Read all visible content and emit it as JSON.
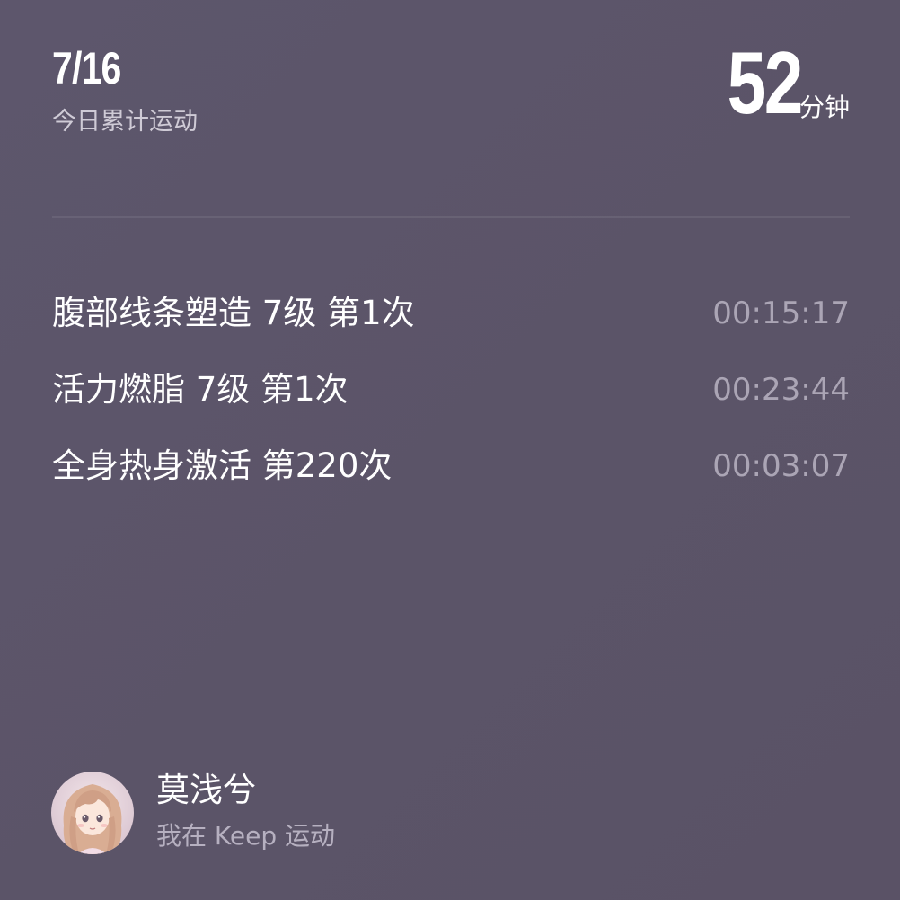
{
  "header": {
    "date": "7/16",
    "subtitle": "今日累计运动",
    "total_value": "52",
    "total_unit": "分钟"
  },
  "workouts": [
    {
      "name": "腹部线条塑造 7级 第1次",
      "duration": "00:15:17"
    },
    {
      "name": "活力燃脂 7级 第1次",
      "duration": "00:23:44"
    },
    {
      "name": "全身热身激活 第220次",
      "duration": "00:03:07"
    }
  ],
  "user": {
    "name": "莫浅兮",
    "caption": "我在 Keep 运动",
    "avatar_icon": "avatar-portrait-icon"
  },
  "colors": {
    "background": "#5c5569",
    "primary_text": "#ffffff",
    "secondary_text": "#cfcbd6",
    "duration_text": "#aba5b5"
  }
}
